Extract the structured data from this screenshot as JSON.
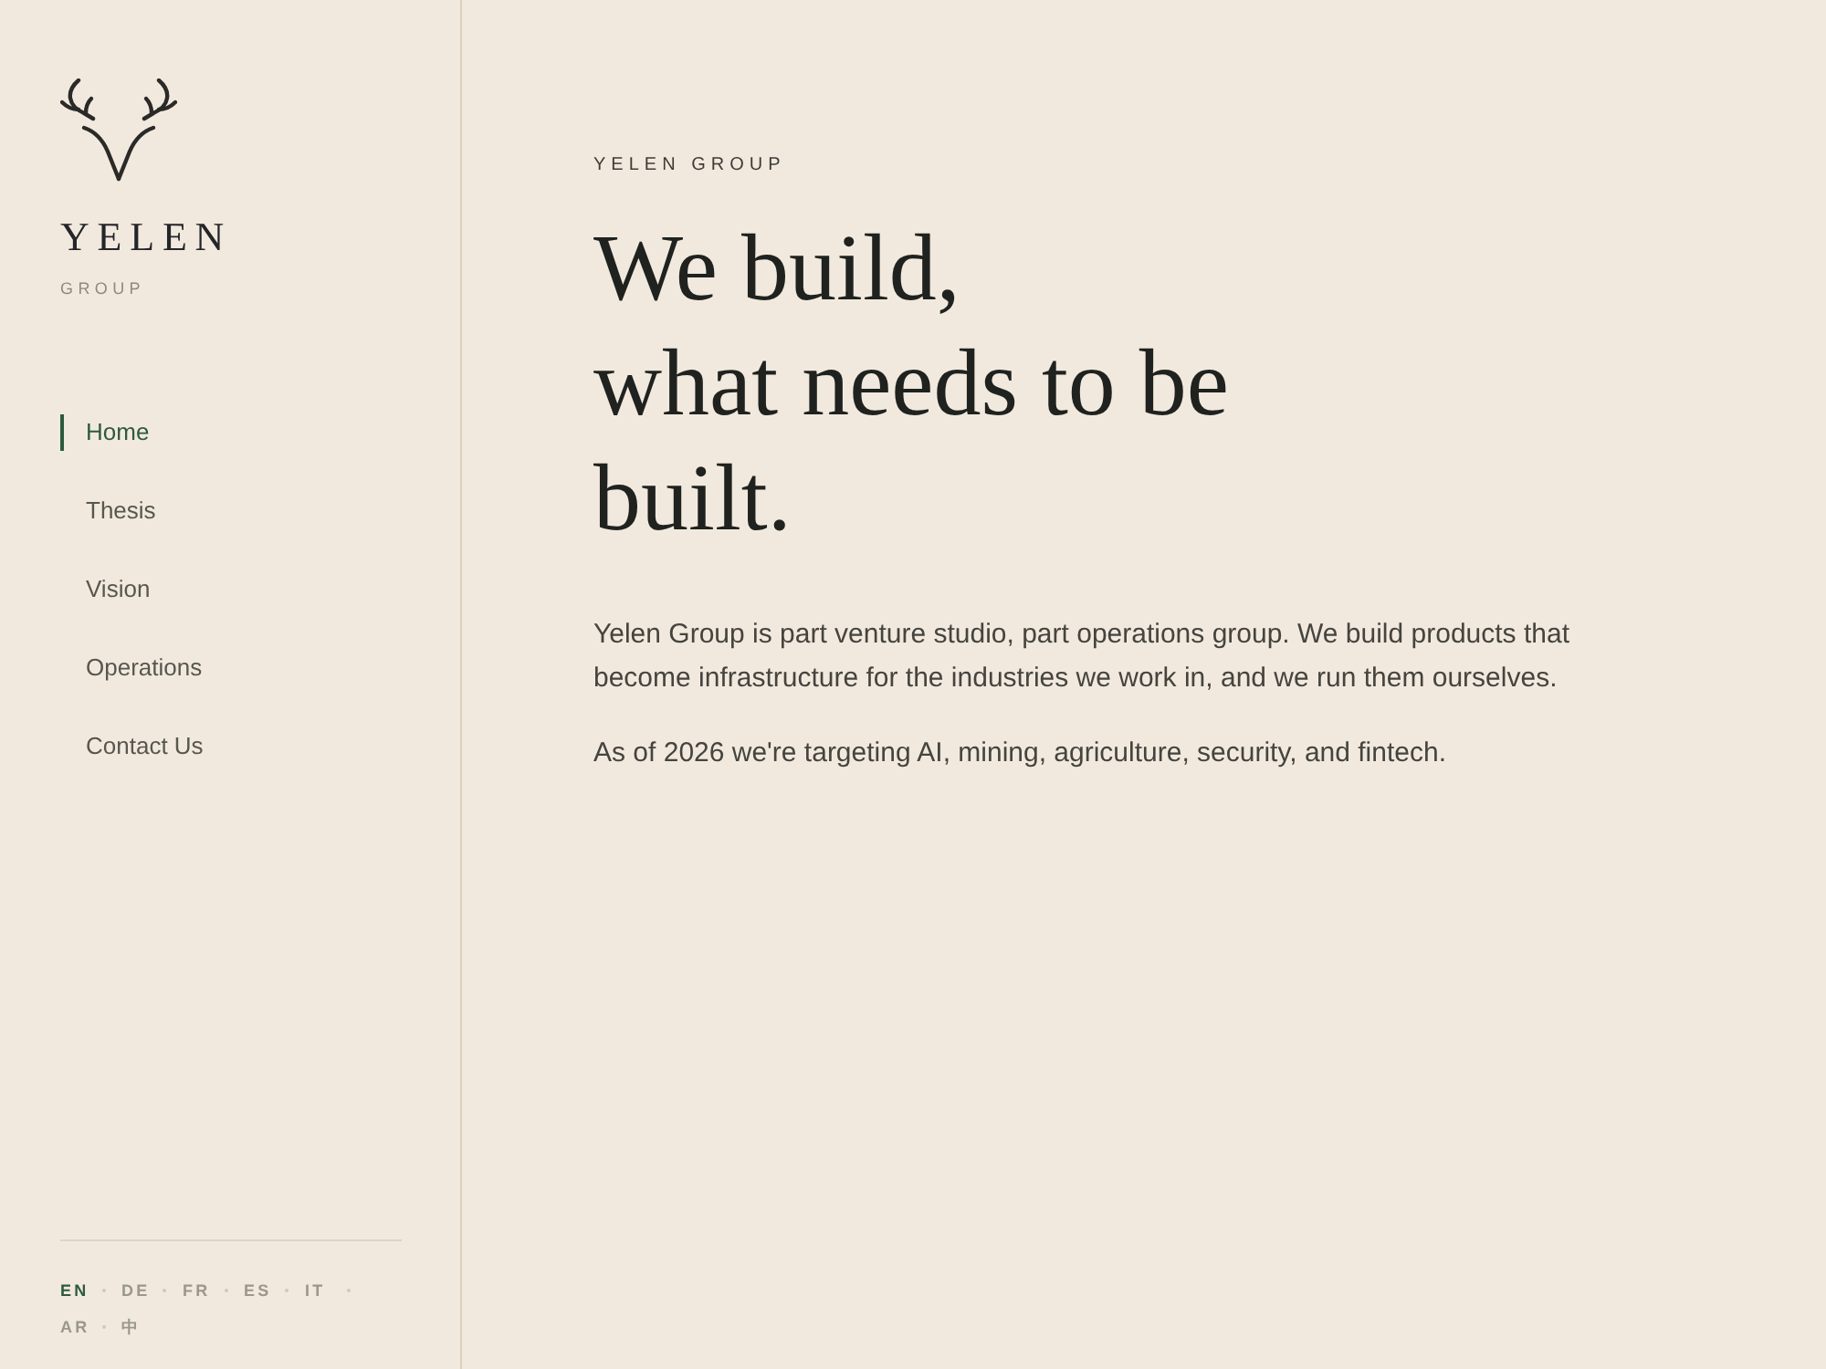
{
  "sidebar": {
    "logo": {
      "wordmark": "YELEN",
      "subtitle": "GROUP"
    },
    "nav": [
      {
        "label": "Home",
        "selected": true
      },
      {
        "label": "Thesis",
        "selected": false
      },
      {
        "label": "Vision",
        "selected": false
      },
      {
        "label": "Operations",
        "selected": false
      },
      {
        "label": "Contact Us",
        "selected": false
      }
    ],
    "languages": [
      {
        "label": "EN",
        "selected": true
      },
      {
        "label": "DE",
        "selected": false
      },
      {
        "label": "FR",
        "selected": false
      },
      {
        "label": "ES",
        "selected": false
      },
      {
        "label": "IT",
        "selected": false
      },
      {
        "label": "AR",
        "selected": false
      },
      {
        "label": "中",
        "selected": false
      }
    ]
  },
  "main": {
    "eyebrow": "YELEN GROUP",
    "headline_lines": [
      "We build,",
      "what needs to be",
      "built."
    ],
    "paragraphs": [
      "Yelen Group is part venture studio, part operations group. We build products that become infrastructure for the industries we work in, and we run them ourselves.",
      "As of 2026 we're targeting AI, mining, agriculture, security, and fintech."
    ]
  }
}
